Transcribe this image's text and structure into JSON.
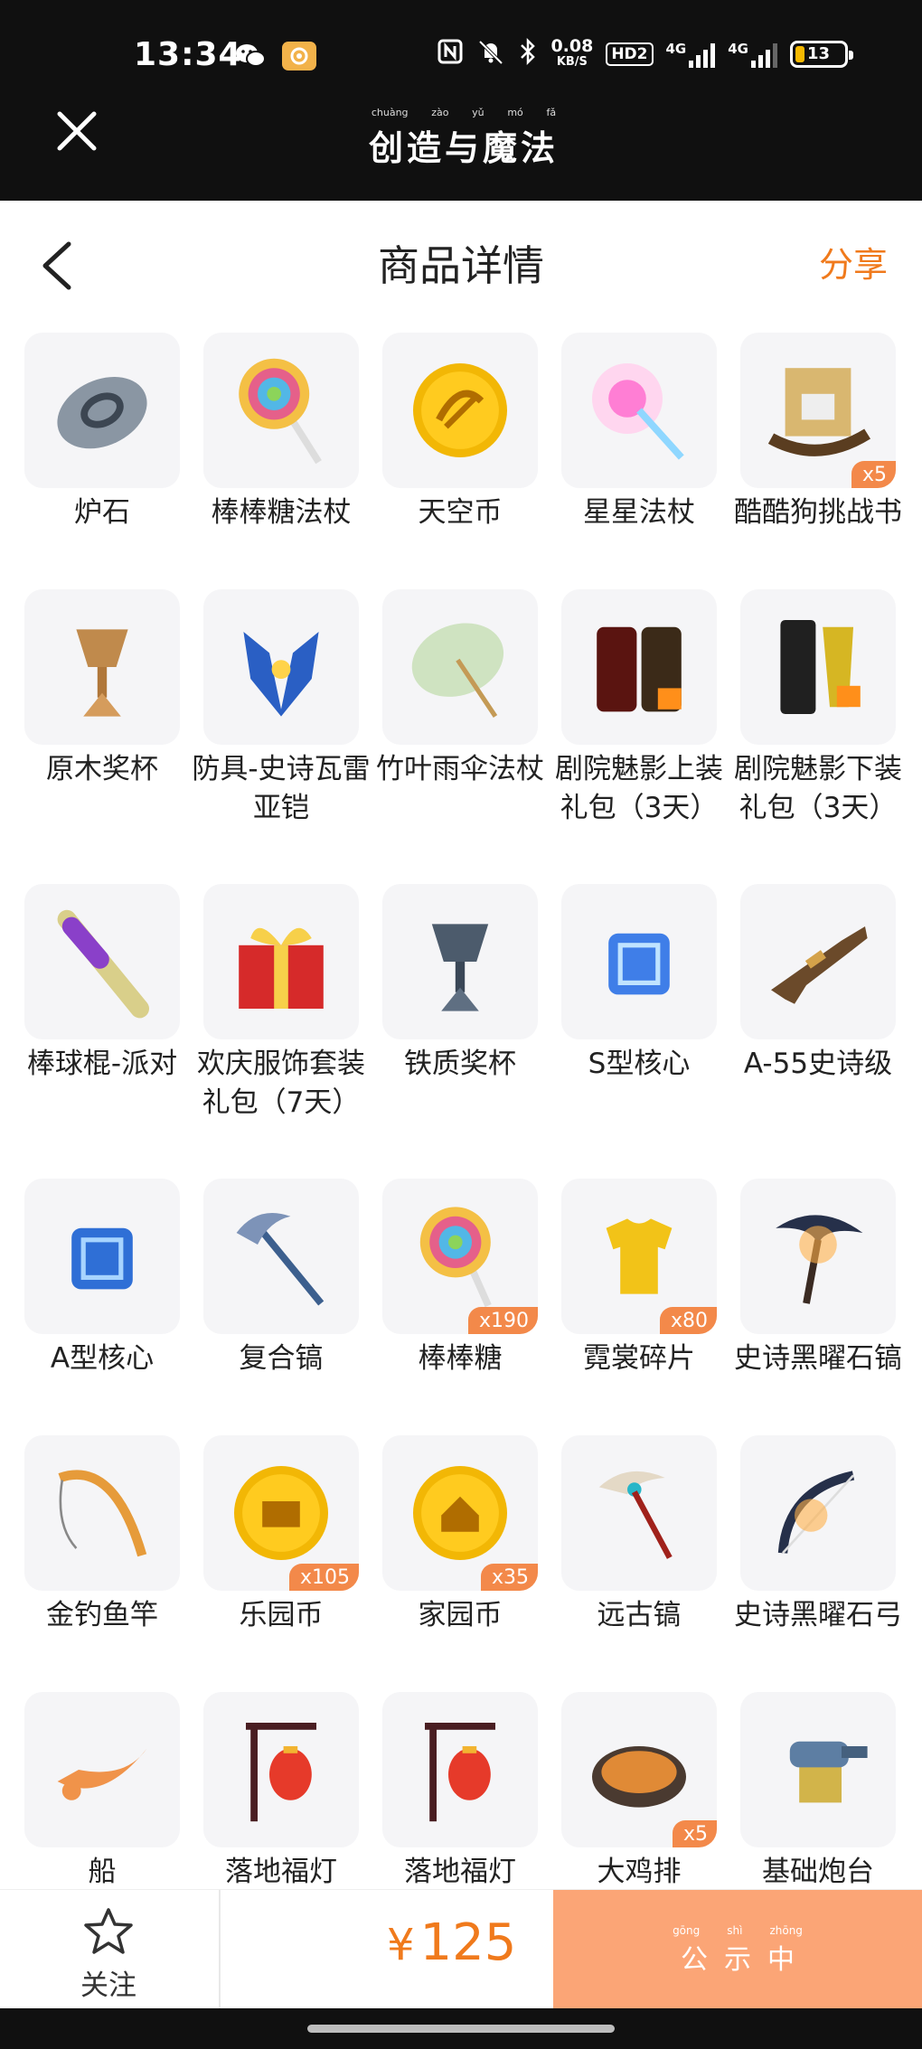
{
  "status_bar": {
    "time": "13:34",
    "speed_value": "0.08",
    "speed_unit": "KB/S",
    "hd_label": "HD2",
    "net1": "4G",
    "net2": "4G",
    "battery": "13",
    "battery_color": "#f5b800"
  },
  "app_header": {
    "title_chars": [
      "创",
      "造",
      "与",
      "魔",
      "法"
    ],
    "title_pinyin": [
      "chuàng",
      "zào",
      "yǔ",
      "mó",
      "fǎ"
    ]
  },
  "nav": {
    "title": "商品详情",
    "share": "分享"
  },
  "items": [
    {
      "name": "炉石",
      "qty": "",
      "icon": "hearthstone-icon"
    },
    {
      "name": "棒棒糖法杖",
      "qty": "",
      "icon": "lollipop-staff-icon"
    },
    {
      "name": "天空币",
      "qty": "",
      "icon": "sky-coin-icon"
    },
    {
      "name": "星星法杖",
      "qty": "",
      "icon": "star-wand-icon"
    },
    {
      "name": "酷酷狗挑战书",
      "qty": "x5",
      "icon": "wanted-scroll-icon"
    },
    {
      "name": "原木奖杯",
      "qty": "",
      "icon": "wood-trophy-icon"
    },
    {
      "name": "防具-史诗瓦雷亚铠",
      "qty": "",
      "icon": "epic-armor-icon"
    },
    {
      "name": "竹叶雨伞法杖",
      "qty": "",
      "icon": "bamboo-umbrella-icon"
    },
    {
      "name": "剧院魅影上装礼包（3天）",
      "qty": "",
      "icon": "phantom-top-pack-icon"
    },
    {
      "name": "剧院魅影下装礼包（3天）",
      "qty": "",
      "icon": "phantom-bottom-pack-icon"
    },
    {
      "name": "棒球棍-派对",
      "qty": "",
      "icon": "party-bat-icon"
    },
    {
      "name": "欢庆服饰套装礼包（7天）",
      "qty": "",
      "icon": "festive-gift-icon"
    },
    {
      "name": "铁质奖杯",
      "qty": "",
      "icon": "iron-trophy-icon"
    },
    {
      "name": "S型核心",
      "qty": "",
      "icon": "s-core-icon"
    },
    {
      "name": "A-55史诗级",
      "qty": "",
      "icon": "a55-gun-icon"
    },
    {
      "name": "A型核心",
      "qty": "",
      "icon": "a-core-icon"
    },
    {
      "name": "复合镐",
      "qty": "",
      "icon": "composite-pickaxe-icon"
    },
    {
      "name": "棒棒糖",
      "qty": "x190",
      "icon": "lollipop-icon"
    },
    {
      "name": "霓裳碎片",
      "qty": "x80",
      "icon": "garment-shard-icon"
    },
    {
      "name": "史诗黑曜石镐",
      "qty": "",
      "icon": "obsidian-pickaxe-icon"
    },
    {
      "name": "金钓鱼竿",
      "qty": "",
      "icon": "gold-fishing-rod-icon"
    },
    {
      "name": "乐园币",
      "qty": "x105",
      "icon": "park-coin-icon"
    },
    {
      "name": "家园币",
      "qty": "x35",
      "icon": "home-coin-icon"
    },
    {
      "name": "远古镐",
      "qty": "",
      "icon": "ancient-pickaxe-icon"
    },
    {
      "name": "史诗黑曜石弓",
      "qty": "",
      "icon": "obsidian-bow-icon"
    },
    {
      "name": "船",
      "qty": "",
      "icon": "boat-icon"
    },
    {
      "name": "落地福灯",
      "qty": "",
      "icon": "lantern-icon"
    },
    {
      "name": "落地福灯",
      "qty": "",
      "icon": "lantern-icon"
    },
    {
      "name": "大鸡排",
      "qty": "x5",
      "icon": "chicken-cutlet-icon"
    },
    {
      "name": "基础炮台",
      "qty": "",
      "icon": "turret-icon"
    }
  ],
  "bottom": {
    "follow": "关注",
    "currency": "¥",
    "price": "125",
    "button_chars": [
      "公",
      "示",
      "中"
    ],
    "button_pinyin": [
      "gōng",
      "shì",
      "zhōng"
    ],
    "accent_color": "#f07a1c",
    "button_color": "#fba576"
  }
}
